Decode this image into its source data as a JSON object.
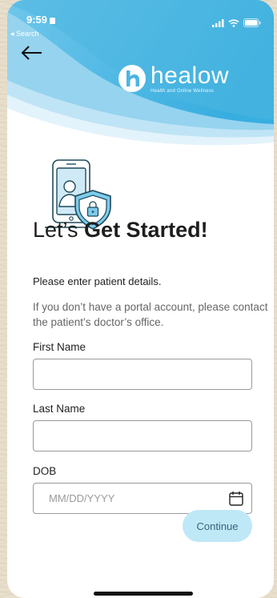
{
  "status_bar": {
    "time": "9:59",
    "back_app": "◂ Search"
  },
  "brand": {
    "name": "healow",
    "tagline": "Health and Online Wellness",
    "accent_color": "#4cb6e0"
  },
  "heading": {
    "light": "Let’s ",
    "bold": "Get Started!"
  },
  "subtitle": "Please enter patient details.",
  "info_text": "If you don’t have a portal account, please contact the patient’s doctor’s office.",
  "form": {
    "first_name": {
      "label": "First Name",
      "value": "",
      "placeholder": ""
    },
    "last_name": {
      "label": "Last Name",
      "value": "",
      "placeholder": ""
    },
    "dob": {
      "label": "DOB",
      "value": "",
      "placeholder": "MM/DD/YYYY"
    }
  },
  "continue_label": "Continue",
  "icons": {
    "back": "arrow-left-icon",
    "calendar": "calendar-icon",
    "illustration": "phone-shield-lock-icon",
    "logo": "healow-logo-icon"
  }
}
